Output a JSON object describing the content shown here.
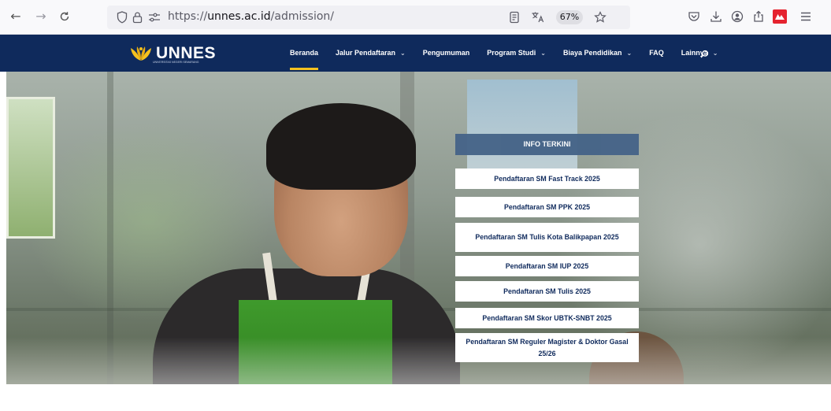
{
  "browser": {
    "back_icon": "←",
    "forward_icon": "→",
    "reload_icon": "C",
    "url_prefix": "https://",
    "url_host": "unnes.ac.id",
    "url_path": "/admission/",
    "zoom": "67%"
  },
  "site": {
    "logo_text": "UNNES",
    "logo_subtitle": "UNIVERSITAS NEGERI SEMARANG",
    "brand_color": "#0f2a5c",
    "accent_color": "#f4c11f",
    "menu": [
      {
        "label": "Beranda",
        "active": true,
        "has_caret": false
      },
      {
        "label": "Jalur Pendaftaran",
        "has_caret": true
      },
      {
        "label": "Pengumuman",
        "has_caret": false
      },
      {
        "label": "Program Studi",
        "has_caret": true
      },
      {
        "label": "Biaya Pendidikan",
        "has_caret": true
      },
      {
        "label": "FAQ",
        "has_caret": false
      },
      {
        "label": "Lainnya",
        "has_caret": true
      }
    ]
  },
  "info": {
    "title": "INFO TERKINI",
    "items": [
      "Pendaftaran SM Fast Track 2025",
      "Pendaftaran SM PPK 2025",
      "Pendaftaran SM Tulis Kota Balikpapan 2025",
      "Pendaftaran SM IUP 2025",
      "Pendaftaran SM Tulis 2025",
      "Pendaftaran SM Skor UBTK-SNBT 2025",
      "Pendaftaran SM Reguler Magister & Doktor Gasal 25/26"
    ]
  }
}
